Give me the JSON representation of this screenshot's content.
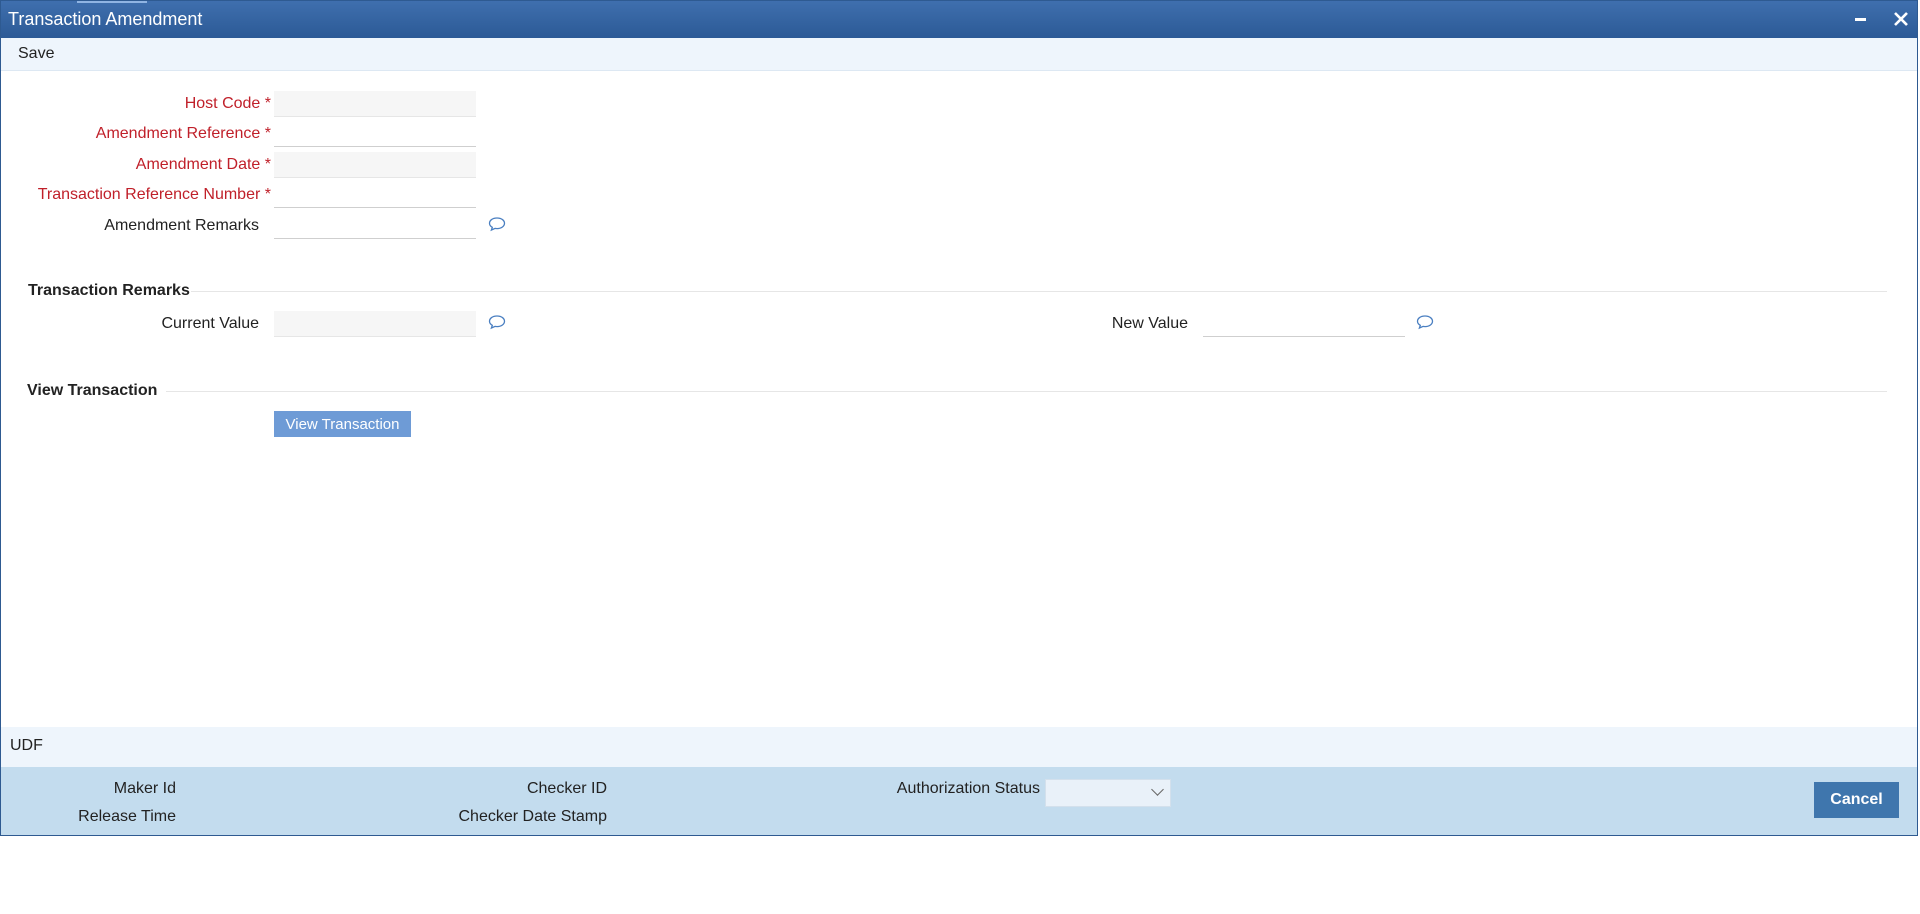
{
  "window": {
    "title": "Transaction Amendment",
    "minimize_icon": "minimize-icon",
    "close_icon": "close-icon"
  },
  "toolbar": {
    "save_label": "Save"
  },
  "form": {
    "host_code": {
      "label": "Host Code",
      "required_mark": "*",
      "value": ""
    },
    "amendment_reference": {
      "label": "Amendment Reference",
      "required_mark": "*",
      "value": ""
    },
    "amendment_date": {
      "label": "Amendment Date",
      "required_mark": "*",
      "value": ""
    },
    "transaction_reference_number": {
      "label": "Transaction Reference Number",
      "required_mark": "*",
      "value": ""
    },
    "amendment_remarks": {
      "label": "Amendment Remarks",
      "value": ""
    }
  },
  "transaction_remarks": {
    "title": "Transaction Remarks",
    "current_value_label": "Current Value",
    "current_value": "",
    "new_value_label": "New Value",
    "new_value": ""
  },
  "view_transaction": {
    "title": "View Transaction",
    "button_label": "View Transaction"
  },
  "udf": {
    "label": "UDF"
  },
  "footer": {
    "maker_id_label": "Maker Id",
    "release_time_label": "Release Time",
    "checker_id_label": "Checker ID",
    "checker_date_stamp_label": "Checker Date Stamp",
    "authorization_status_label": "Authorization Status",
    "authorization_status_value": "",
    "cancel_label": "Cancel"
  },
  "colors": {
    "title_bar": "#2c5a96",
    "required_label": "#c0202a",
    "view_button": "#6e9bd6",
    "footer_bg": "#c3dcee",
    "cancel_button": "#3f76ad"
  }
}
